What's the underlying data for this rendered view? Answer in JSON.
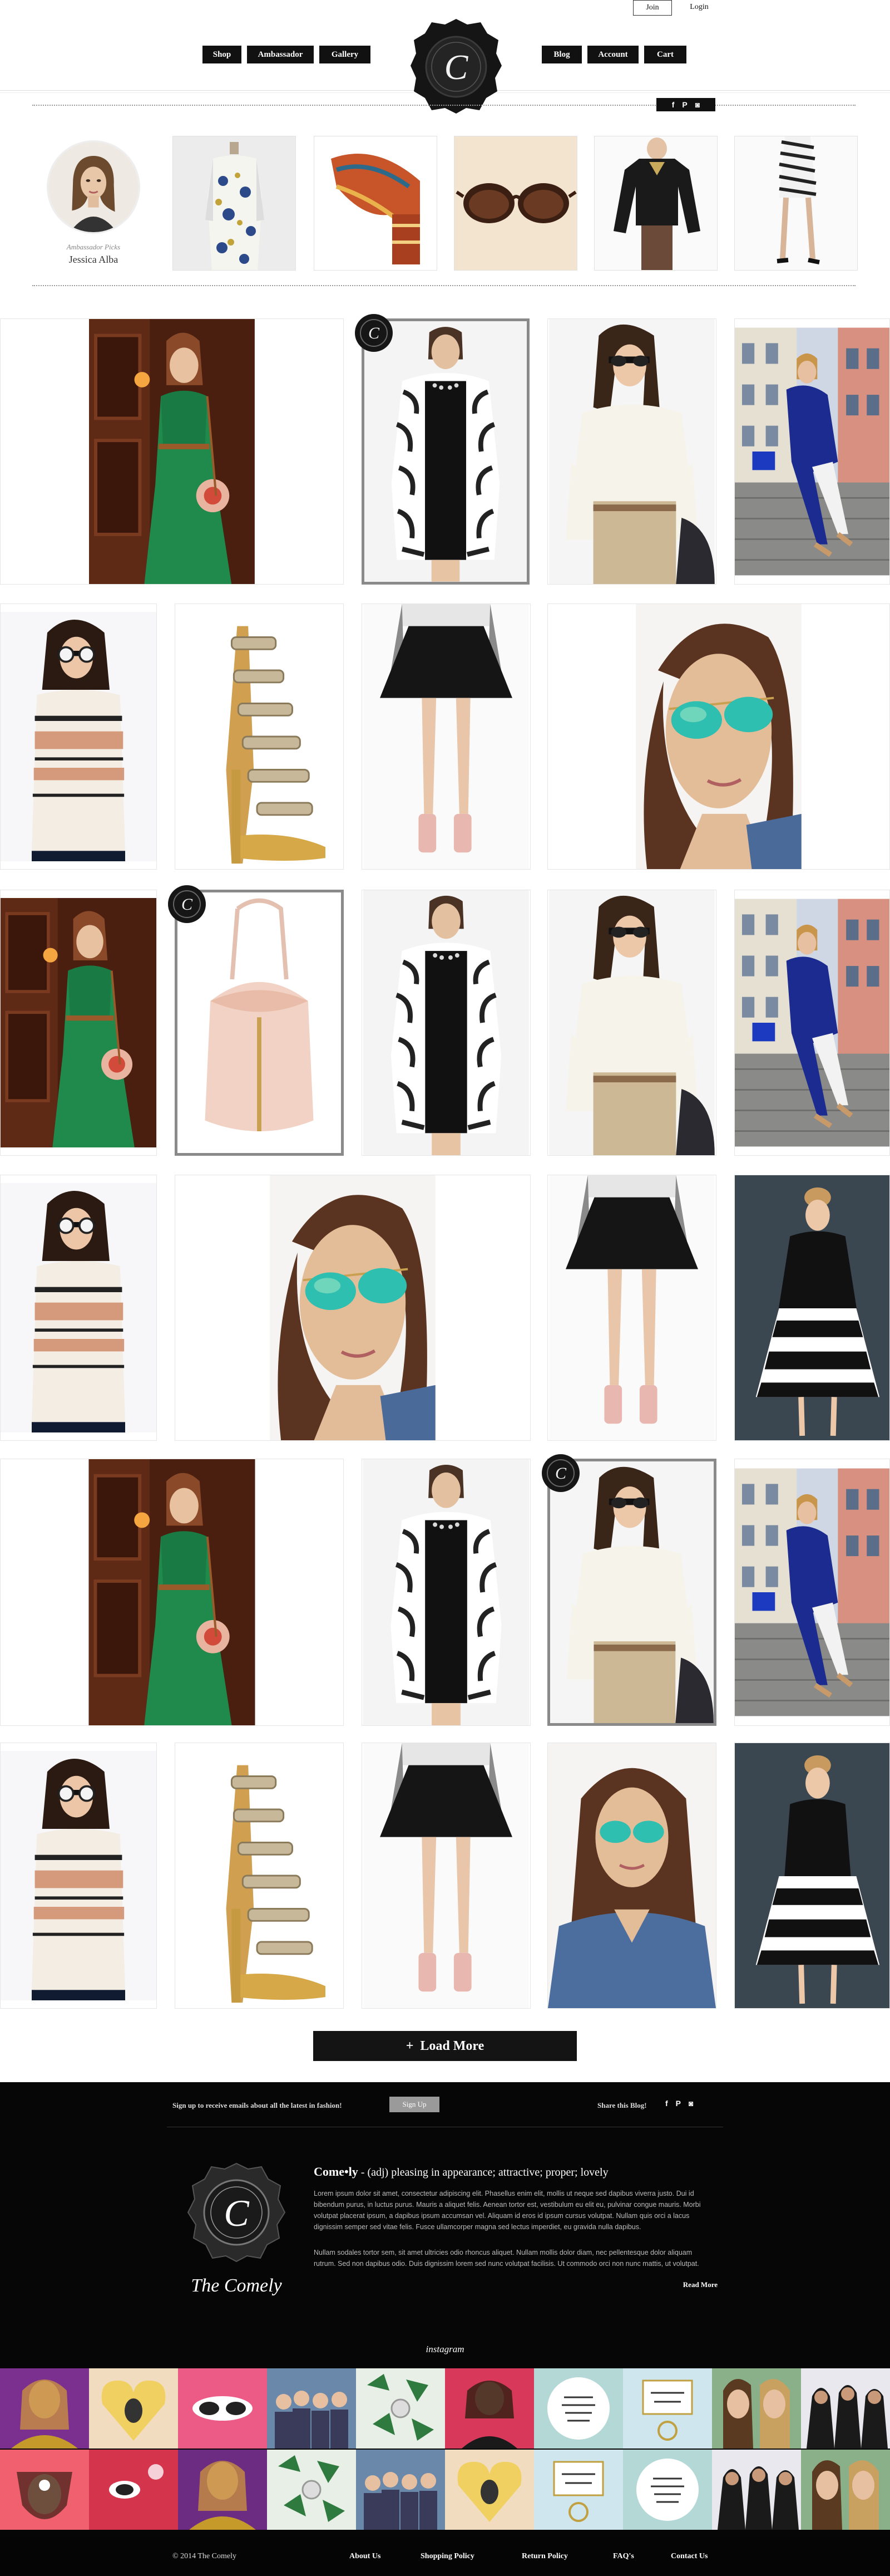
{
  "header": {
    "join_label": "Join",
    "login_label": "Login",
    "nav_left": [
      "Shop",
      "Ambassador",
      "Gallery"
    ],
    "nav_right": [
      "Blog",
      "Account",
      "Cart"
    ],
    "logo_letter": "C"
  },
  "social": {
    "icons": [
      "f",
      "P",
      "◙"
    ]
  },
  "ambassador": {
    "label": "Ambassador Picks",
    "name": "Jessica Alba"
  },
  "strip_items": [
    "floral-dress",
    "wedge-sandal",
    "tortoise-sunglasses",
    "black-blouse",
    "zebra-skirt"
  ],
  "load_more": {
    "icon": "+",
    "label": "Load More"
  },
  "footer": {
    "signup_text": "Sign up to receive emails about all the latest in fashion!",
    "signup_button": "Sign Up",
    "share_text": "Share this Blog!",
    "share_icons": [
      "f",
      "P",
      "◙"
    ],
    "brand_script": "The Comely",
    "def_word": "Come•ly",
    "def_body": " - (adj) pleasing in appearance; attractive; proper; lovely",
    "lorem1": "Lorem ipsum dolor sit amet, consectetur adipiscing elit. Phasellus enim elit, mollis ut neque sed dapibus viverra justo. Dui id bibendum purus, in luctus purus. Mauris a aliquet felis. Aenean tortor est, vestibulum eu elit eu, pulvinar congue mauris. Morbi volutpat placerat ipsum, a dapibus ipsum accumsan vel. Aliquam id eros id ipsum cursus volutpat. Nullam quis orci a lacus dignissim semper sed vitae felis. Fusce ullamcorper magna sed lectus imperdiet, eu gravida nulla dapibus.",
    "lorem2": "Nullam sodales tortor sem, sit amet ultricies odio rhoncus aliquet. Nullam mollis dolor diam, nec pellentesque dolor aliquam rutrum. Sed non dapibus odio. Duis dignissim lorem sed nunc volutpat facilisis. Ut commodo orci non nunc mattis, ut volutpat.",
    "read_more": "Read More",
    "instagram_title": "instagram",
    "copyright": "© 2014 The Comely",
    "links": [
      "About Us",
      "Shopping Policy",
      "Return Policy",
      "FAQ's",
      "Contact Us"
    ]
  },
  "colors": {
    "black": "#111111",
    "green_dress": "#1f8a4c",
    "cobalt": "#1c2b8f",
    "mirror_lens": "#2fbfb0"
  }
}
